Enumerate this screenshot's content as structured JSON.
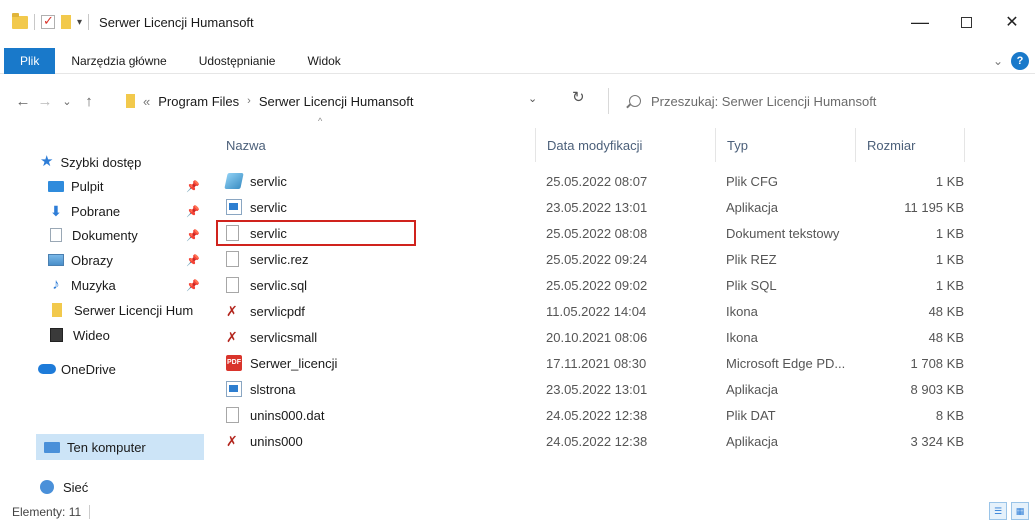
{
  "window": {
    "title": "Serwer Licencji Humansoft",
    "controls": {
      "minimize": "—",
      "close": "✕"
    }
  },
  "ribbon": {
    "tabs": [
      "Plik",
      "Narzędzia główne",
      "Udostępnianie",
      "Widok"
    ],
    "help": "?"
  },
  "address": {
    "back": "←",
    "forward": "→",
    "recent": "⌄",
    "up": "↑",
    "lead": "«",
    "crumbs": [
      "Program Files",
      "Serwer Licencji Humansoft"
    ],
    "crumb_sep": "›",
    "dropdown": "⌄",
    "refresh": "↻",
    "search_placeholder": "Przeszukaj: Serwer Licencji Humansoft"
  },
  "sidebar": {
    "pin_glyph": "📌",
    "items": [
      {
        "label": "Szybki dostęp",
        "icon": "star-icon"
      },
      {
        "label": "Pulpit",
        "icon": "desktop-icon",
        "pinned": true
      },
      {
        "label": "Pobrane",
        "icon": "download-icon",
        "pinned": true
      },
      {
        "label": "Dokumenty",
        "icon": "document-icon",
        "pinned": true
      },
      {
        "label": "Obrazy",
        "icon": "pictures-icon",
        "pinned": true
      },
      {
        "label": "Muzyka",
        "icon": "music-icon",
        "pinned": true
      },
      {
        "label": "Serwer Licencji Hum",
        "icon": "folder-icon"
      },
      {
        "label": "Wideo",
        "icon": "video-icon"
      },
      {
        "label": "OneDrive",
        "icon": "cloud-icon"
      },
      {
        "label": "Ten komputer",
        "icon": "computer-icon",
        "selected": true
      },
      {
        "label": "Sieć",
        "icon": "network-icon"
      }
    ]
  },
  "columns": {
    "name": "Nazwa",
    "date": "Data modyfikacji",
    "type": "Typ",
    "size": "Rozmiar",
    "sort_indicator": "^"
  },
  "files": [
    {
      "name": "servlic",
      "date": "25.05.2022 08:07",
      "type": "Plik CFG",
      "size": "1 KB",
      "icon": "cfg-file-icon"
    },
    {
      "name": "servlic",
      "date": "23.05.2022 13:01",
      "type": "Aplikacja",
      "size": "11 195 KB",
      "icon": "application-icon"
    },
    {
      "name": "servlic",
      "date": "25.05.2022 08:08",
      "type": "Dokument tekstowy",
      "size": "1 KB",
      "icon": "text-file-icon",
      "highlighted": true
    },
    {
      "name": "servlic.rez",
      "date": "25.05.2022 09:24",
      "type": "Plik REZ",
      "size": "1 KB",
      "icon": "blank-file-icon"
    },
    {
      "name": "servlic.sql",
      "date": "25.05.2022 09:02",
      "type": "Plik SQL",
      "size": "1 KB",
      "icon": "blank-file-icon"
    },
    {
      "name": "servlicpdf",
      "date": "11.05.2022 14:04",
      "type": "Ikona",
      "size": "48 KB",
      "icon": "icon-file-icon"
    },
    {
      "name": "servlicsmall",
      "date": "20.10.2021 08:06",
      "type": "Ikona",
      "size": "48 KB",
      "icon": "icon-file-icon"
    },
    {
      "name": "Serwer_licencji",
      "date": "17.11.2021 08:30",
      "type": "Microsoft Edge PD...",
      "size": "1 708 KB",
      "icon": "pdf-icon"
    },
    {
      "name": "slstrona",
      "date": "23.05.2022 13:01",
      "type": "Aplikacja",
      "size": "8 903 KB",
      "icon": "application-icon"
    },
    {
      "name": "unins000.dat",
      "date": "24.05.2022 12:38",
      "type": "Plik DAT",
      "size": "8 KB",
      "icon": "blank-file-icon"
    },
    {
      "name": "unins000",
      "date": "24.05.2022 12:38",
      "type": "Aplikacja",
      "size": "3 324 KB",
      "icon": "icon-file-icon"
    }
  ],
  "status": {
    "count": "Elementy: 11"
  },
  "colors": {
    "accent": "#1979ca",
    "selection": "#cce4f7",
    "highlight_border": "#d0231d"
  }
}
